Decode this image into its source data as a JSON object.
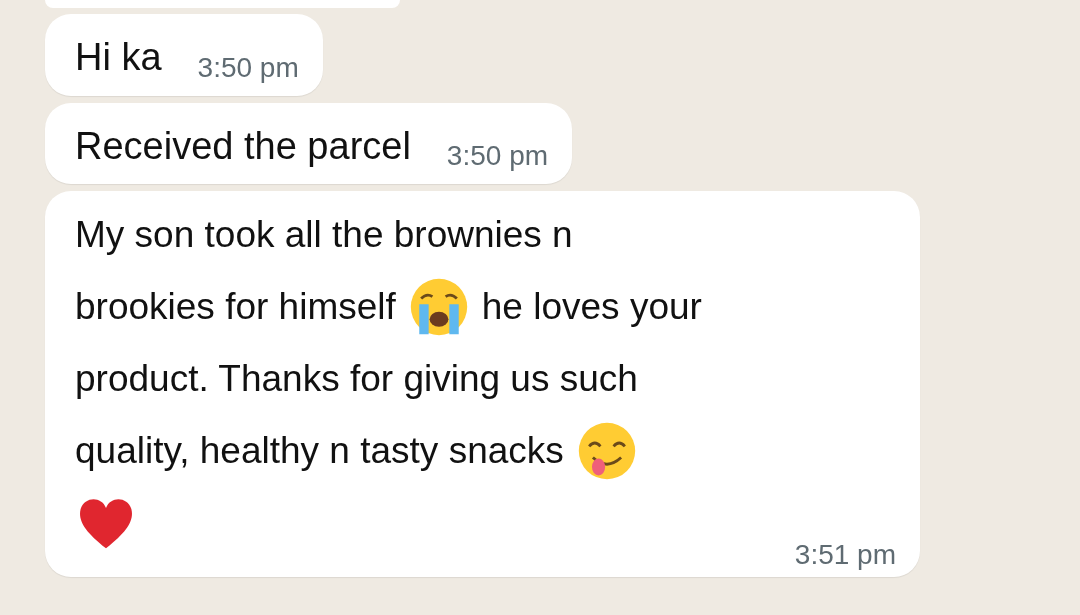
{
  "messages": [
    {
      "lines": [
        [
          {
            "kind": "text",
            "text": "Hi ka"
          }
        ]
      ],
      "time": "3:50 pm"
    },
    {
      "lines": [
        [
          {
            "kind": "text",
            "text": "Received the parcel"
          }
        ]
      ],
      "time": "3:50 pm"
    },
    {
      "lines": [
        [
          {
            "kind": "text",
            "text": "My son took all the brownies n"
          }
        ],
        [
          {
            "kind": "text",
            "text": "brookies for himself"
          },
          {
            "kind": "crying"
          },
          {
            "kind": "text",
            "text": "he loves your"
          }
        ],
        [
          {
            "kind": "text",
            "text": "product. Thanks for giving us such"
          }
        ],
        [
          {
            "kind": "text",
            "text": "quality, healthy n tasty snacks"
          },
          {
            "kind": "yum"
          }
        ],
        [
          {
            "kind": "heart"
          }
        ]
      ],
      "time": "3:51 pm"
    }
  ]
}
